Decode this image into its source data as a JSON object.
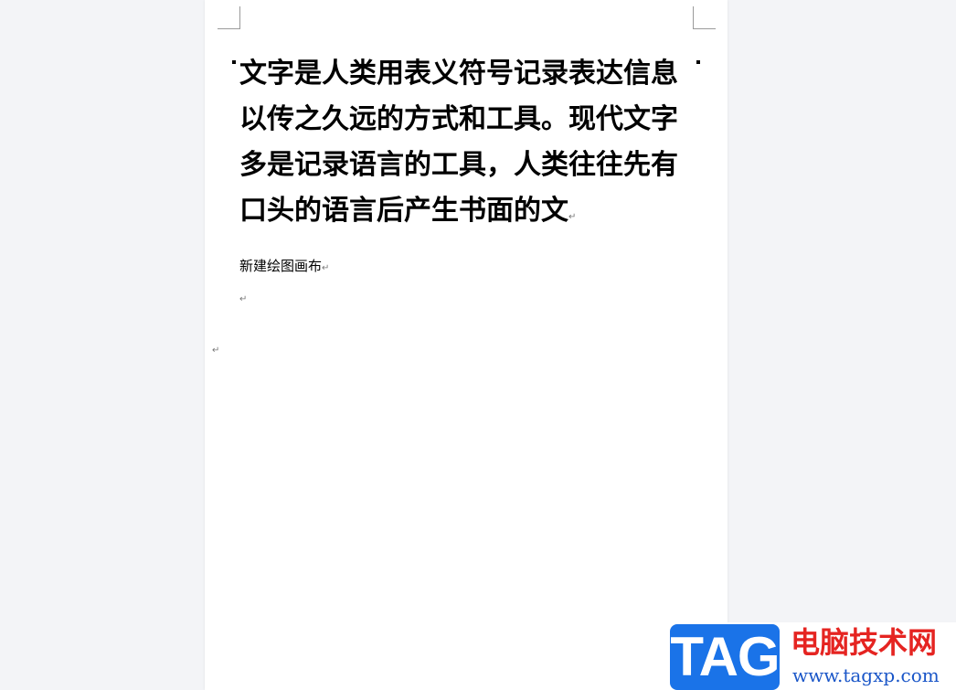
{
  "document": {
    "body_text": "文字是人类用表义符号记录表达信息以传之久远的方式和工具。现代文字多是记录语言的工具，人类往往先有口头的语言后产生书面的文",
    "canvas_label": "新建绘图画布",
    "paragraph_mark": "↵"
  },
  "watermark": {
    "badge": "TAG",
    "title": "电脑技术网",
    "url": "www.tagxp.com",
    "colors": {
      "badge_bg": "#1a73e8",
      "title": "#e52421",
      "url": "#1a56c8"
    }
  },
  "colors": {
    "workspace_bg": "#f3f4f7",
    "page_bg": "#ffffff"
  }
}
